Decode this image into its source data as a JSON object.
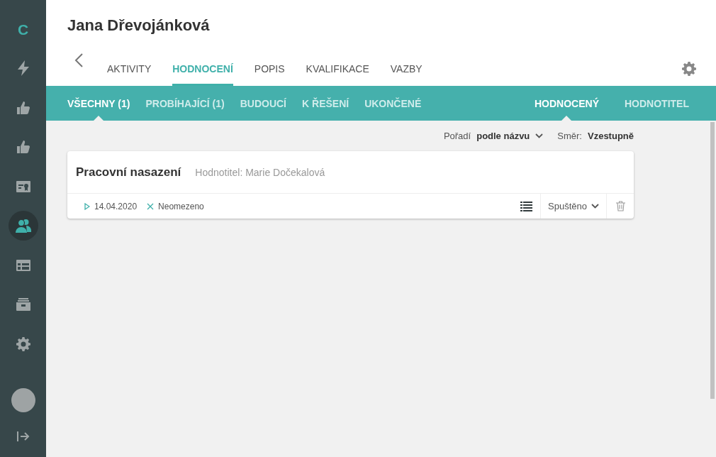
{
  "sidebar": {
    "logo": "C",
    "items": [
      {
        "selected": false
      },
      {
        "selected": false
      },
      {
        "selected": false
      },
      {
        "selected": false
      },
      {
        "selected": true
      },
      {
        "selected": false
      },
      {
        "selected": false
      },
      {
        "selected": false
      }
    ]
  },
  "header": {
    "title": "Jana Dřevojánková"
  },
  "tabs": [
    {
      "label": "AKTIVITY",
      "selected": false
    },
    {
      "label": "HODNOCENÍ",
      "selected": true
    },
    {
      "label": "POPIS",
      "selected": false
    },
    {
      "label": "KVALIFIKACE",
      "selected": false
    },
    {
      "label": "VAZBY",
      "selected": false
    }
  ],
  "filters": [
    {
      "label": "VŠECHNY (1)",
      "selected": true
    },
    {
      "label": "PROBÍHAJÍCÍ (1)",
      "selected": false
    },
    {
      "label": "BUDOUCÍ",
      "selected": false
    },
    {
      "label": "K ŘEŠENÍ",
      "selected": false
    },
    {
      "label": "UKONČENÉ",
      "selected": false
    }
  ],
  "roles": [
    {
      "label": "HODNOCENÝ",
      "selected": true
    },
    {
      "label": "HODNOTITEL",
      "selected": false
    }
  ],
  "sort": {
    "order": "Pořadí **podle názvu**",
    "direction": "Směr: **Vzestupně**"
  },
  "cards": [
    {
      "title": "Pracovní nasazení",
      "evaluator": "Hodnotitel: Marie Dočekalová",
      "start": "14.04.2020",
      "end": "Neomezeno",
      "status": "Spuštěno"
    }
  ]
}
